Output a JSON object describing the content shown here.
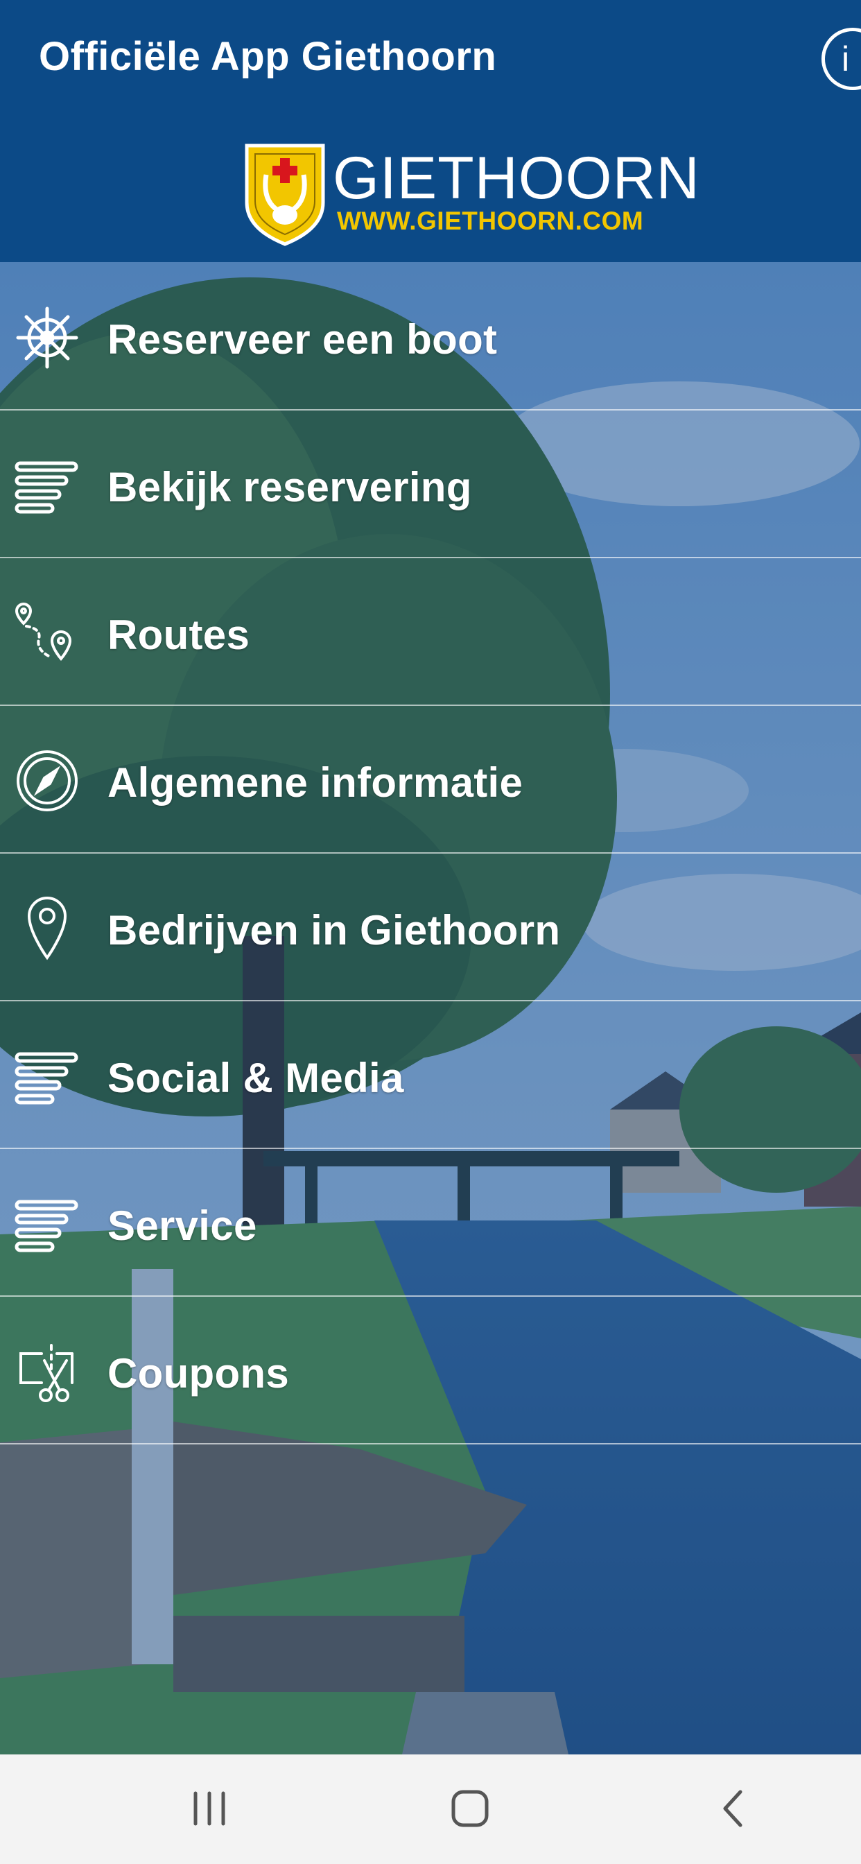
{
  "header": {
    "title": "Officiële App Giethoorn",
    "info_glyph": "i",
    "info_icon": "info-circle-icon",
    "logo": {
      "name": "GIETHOORN",
      "url": "WWW.GIETHOORN.COM",
      "shield_icon": "giethoorn-crest-icon"
    }
  },
  "menu": {
    "items": [
      {
        "label": "Reserveer een boot",
        "icon": "ship-wheel-icon"
      },
      {
        "label": "Bekijk reservering",
        "icon": "lines-list-icon"
      },
      {
        "label": "Routes",
        "icon": "route-pins-icon"
      },
      {
        "label": "Algemene informatie",
        "icon": "compass-icon"
      },
      {
        "label": "Bedrijven in Giethoorn",
        "icon": "location-pin-icon"
      },
      {
        "label": "Social & Media",
        "icon": "lines-list-icon"
      },
      {
        "label": "Service",
        "icon": "lines-list-icon"
      },
      {
        "label": "Coupons",
        "icon": "scissors-coupon-icon"
      }
    ]
  },
  "navbar": {
    "recents_icon": "recent-apps-icon",
    "home_icon": "home-icon",
    "back_icon": "back-icon"
  },
  "colors": {
    "header_bg": "#0c4a87",
    "overlay": "#114687",
    "logo_url": "#f2c600",
    "text": "#ffffff",
    "navbar_bg": "#f3f3f3"
  }
}
